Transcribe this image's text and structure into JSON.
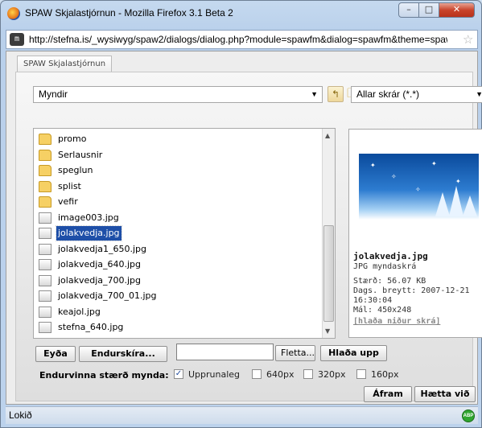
{
  "window": {
    "title": "SPAW Skjalastjórnun - Mozilla Firefox 3.1 Beta 2",
    "url": "http://stefna.is/_wysiwyg/spaw2/dialogs/dialog.php?module=spawfm&dialog=spawfm&theme=spaw",
    "site_icon": "m"
  },
  "tab": {
    "label": "SPAW Skjalastjórnun"
  },
  "toolbar": {
    "directory": "Myndir",
    "filter": "Allar skrár (*.*)"
  },
  "files": [
    {
      "name": "promo",
      "type": "folder"
    },
    {
      "name": "Serlausnir",
      "type": "folder"
    },
    {
      "name": "speglun",
      "type": "folder"
    },
    {
      "name": "splist",
      "type": "folder"
    },
    {
      "name": "vefir",
      "type": "folder"
    },
    {
      "name": "image003.jpg",
      "type": "image"
    },
    {
      "name": "jolakvedja.jpg",
      "type": "image",
      "selected": true
    },
    {
      "name": "jolakvedja1_650.jpg",
      "type": "image"
    },
    {
      "name": "jolakvedja_640.jpg",
      "type": "image"
    },
    {
      "name": "jolakvedja_700.jpg",
      "type": "image"
    },
    {
      "name": "jolakvedja_700_01.jpg",
      "type": "image"
    },
    {
      "name": "keajol.jpg",
      "type": "image"
    },
    {
      "name": "stefna_640.jpg",
      "type": "image"
    }
  ],
  "preview": {
    "filename": "jolakvedja.jpg",
    "filetype": "JPG myndaskrá",
    "size": "Stærð: 56.07 KB",
    "modified": "Dags. breytt: 2007-12-21",
    "modified_time": "16:30:04",
    "dimensions": "Mál: 450x248",
    "download_link": "[hlaða niður skrá]"
  },
  "actions": {
    "delete": "Eyða",
    "rename": "Endurskíra...",
    "browse": "Fletta...",
    "upload": "Hlaða upp"
  },
  "resize": {
    "label": "Endurvinna stærð mynda:",
    "options": [
      {
        "label": "Upprunaleg",
        "checked": true
      },
      {
        "label": "640px",
        "checked": false
      },
      {
        "label": "320px",
        "checked": false
      },
      {
        "label": "160px",
        "checked": false
      }
    ]
  },
  "dialog_buttons": {
    "ok": "Áfram",
    "cancel": "Hætta við"
  },
  "status": {
    "text": "Lokið",
    "addon_icon": "ABP"
  }
}
